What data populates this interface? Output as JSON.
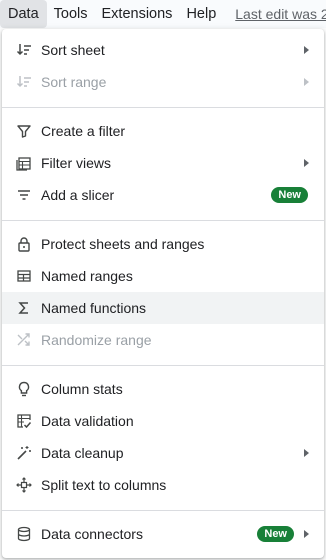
{
  "menubar": {
    "items": [
      "Data",
      "Tools",
      "Extensions",
      "Help"
    ],
    "last_edit": "Last edit was 2"
  },
  "menu": {
    "sort_sheet": "Sort sheet",
    "sort_range": "Sort range",
    "create_filter": "Create a filter",
    "filter_views": "Filter views",
    "add_slicer": "Add a slicer",
    "protect": "Protect sheets and ranges",
    "named_ranges": "Named ranges",
    "named_functions": "Named functions",
    "randomize_range": "Randomize range",
    "column_stats": "Column stats",
    "data_validation": "Data validation",
    "data_cleanup": "Data cleanup",
    "split_text": "Split text to columns",
    "data_connectors": "Data connectors",
    "new_badge": "New"
  },
  "colors": {
    "badge": "#188038",
    "hover": "#f1f3f4",
    "disabled_text": "#9aa0a6"
  }
}
